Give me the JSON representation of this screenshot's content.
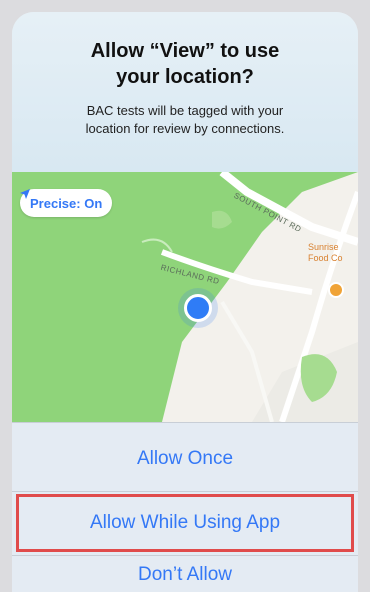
{
  "dialog": {
    "title_line1": "Allow “View” to use",
    "title_line2": "your location?",
    "message_line1": "BAC tests will be tagged with your",
    "message_line2": "location for review by connections."
  },
  "map": {
    "precise_label": "Precise: On",
    "street_top": "SOUTH POINT RD",
    "street_mid": "RICHLAND RD",
    "poi_line1": "Sunrise",
    "poi_line2": "Food Co",
    "accent_color": "#3478f6"
  },
  "actions": {
    "allow_once": "Allow Once",
    "allow_while_using": "Allow While Using App",
    "dont_allow": "Don’t Allow"
  },
  "annotation": {
    "highlight_color": "#e04b4b"
  }
}
